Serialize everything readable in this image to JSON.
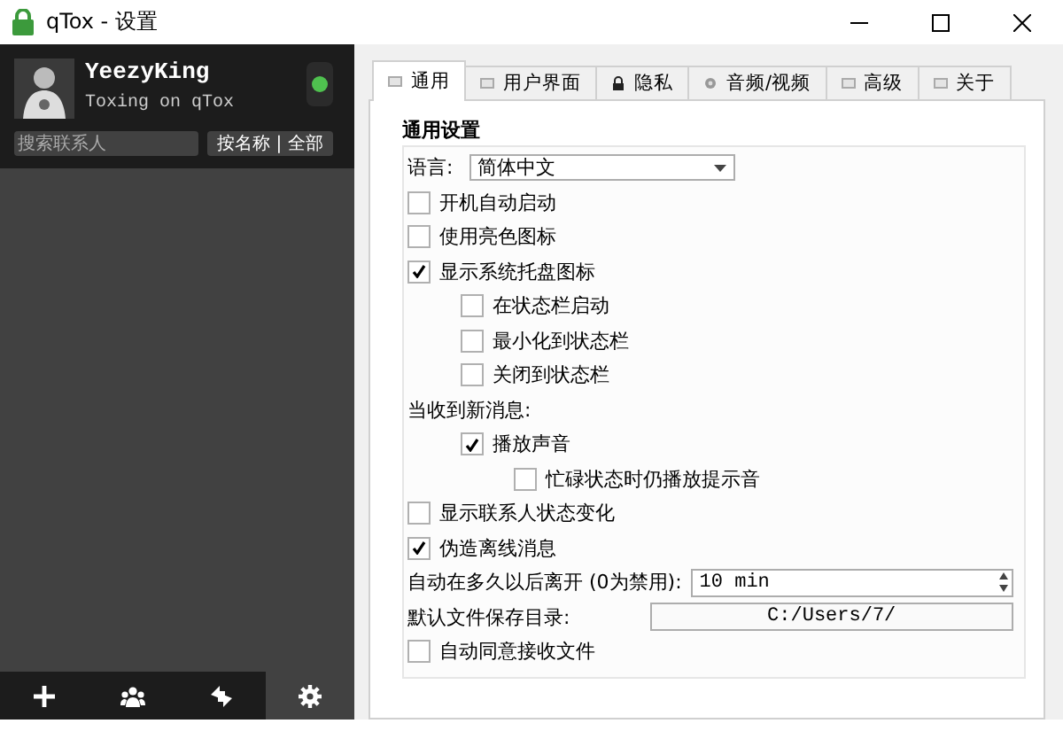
{
  "window": {
    "title": "qTox - 设置"
  },
  "profile": {
    "name": "YeezyKing",
    "status_message": "Toxing on qTox",
    "online": true
  },
  "contact_search": {
    "placeholder": "搜索联系人"
  },
  "filter_button": "按名称 | 全部",
  "bottom_bar": [
    {
      "kind": "add",
      "selected": false
    },
    {
      "kind": "group",
      "selected": false
    },
    {
      "kind": "transfer",
      "selected": false
    },
    {
      "kind": "settings",
      "selected": true
    }
  ],
  "tabs": [
    {
      "label": "通用",
      "kind": "page",
      "selected": true
    },
    {
      "label": "用户界面",
      "kind": "page",
      "selected": false
    },
    {
      "label": "隐私",
      "kind": "lock",
      "selected": false
    },
    {
      "label": "音频/视频",
      "kind": "speaker",
      "selected": false
    },
    {
      "label": "高级",
      "kind": "page",
      "selected": false
    },
    {
      "label": "关于",
      "kind": "page",
      "selected": false
    }
  ],
  "group_title": "通用设置",
  "settings": [
    {
      "kind": "select",
      "label": "语言:",
      "value": "简体中文"
    },
    {
      "kind": "checkbox",
      "label": "开机自动启动",
      "checked": false
    },
    {
      "kind": "checkbox",
      "label": "使用亮色图标",
      "checked": false
    },
    {
      "kind": "checkbox",
      "label": "显示系统托盘图标",
      "checked": true,
      "children": [
        {
          "kind": "checkbox",
          "label": "在状态栏启动",
          "checked": false
        },
        {
          "kind": "checkbox",
          "label": "最小化到状态栏",
          "checked": false
        },
        {
          "kind": "checkbox",
          "label": "关闭到状态栏",
          "checked": false
        }
      ]
    },
    {
      "kind": "label",
      "label": "当收到新消息:",
      "children": [
        {
          "kind": "checkbox",
          "label": "播放声音",
          "checked": true,
          "children": [
            {
              "kind": "checkbox",
              "label": "忙碌状态时仍播放提示音",
              "checked": false
            }
          ]
        }
      ]
    },
    {
      "kind": "checkbox",
      "label": "显示联系人状态变化",
      "checked": false
    },
    {
      "kind": "checkbox",
      "label": "伪造离线消息",
      "checked": true
    },
    {
      "kind": "spin",
      "label": "自动在多久以后离开 (0为禁用):",
      "value": "10 min"
    },
    {
      "kind": "path",
      "label": "默认文件保存目录:",
      "value": "C:/Users/7/"
    },
    {
      "kind": "checkbox",
      "label": "自动同意接收文件",
      "checked": false
    }
  ]
}
